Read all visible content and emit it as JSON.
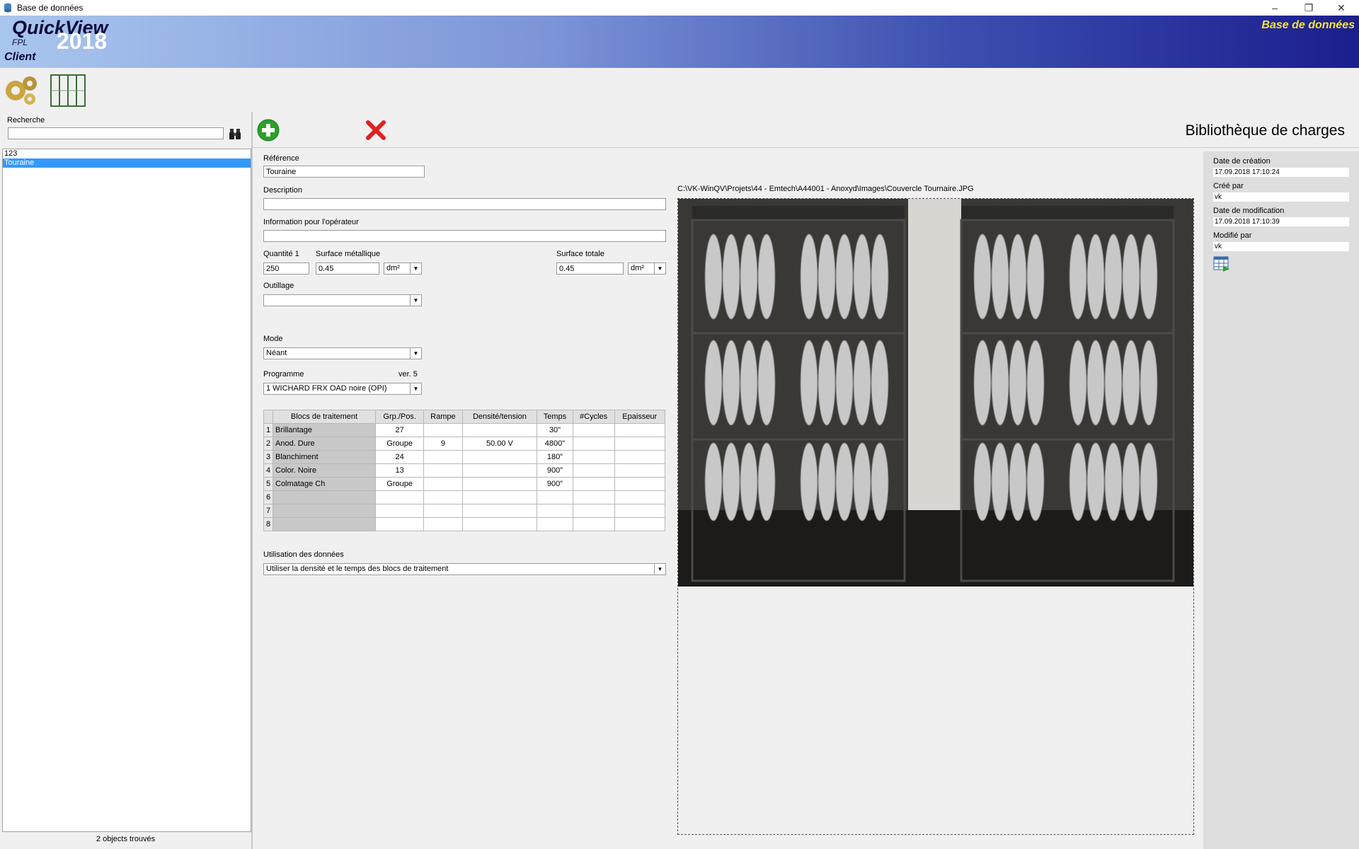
{
  "window": {
    "title": "Base de données"
  },
  "banner": {
    "app_name": "QuickView",
    "sub": "FPL",
    "year": "2018",
    "mode": "Client",
    "section": "Base de données"
  },
  "search": {
    "label": "Recherche",
    "value": ""
  },
  "list": {
    "items": [
      "123",
      "Touraine"
    ],
    "selected": "Touraine",
    "status": "2 objects trouvés"
  },
  "header": {
    "title": "Bibliothèque de charges"
  },
  "form": {
    "reference_label": "Référence",
    "reference_value": "Touraine",
    "description_label": "Description",
    "description_value": "",
    "info_label": "Information pour l'opérateur",
    "info_value": "",
    "quantity_label": "Quantité 1",
    "quantity_value": "250",
    "metal_surface_label": "Surface métallique",
    "metal_surface_value": "0.45",
    "metal_surface_unit": "dm²",
    "total_surface_label": "Surface totale",
    "total_surface_value": "0.45",
    "total_surface_unit": "dm²",
    "tooling_label": "Outillage",
    "tooling_value": "",
    "mode_label": "Mode",
    "mode_value": "Néant",
    "program_label": "Programme",
    "program_version": "ver. 5",
    "program_value": "1 WICHARD FRX OAD noire (OPI)",
    "usage_label": "Utilisation des données",
    "usage_value": "Utiliser la densité et le temps des blocs de traitement"
  },
  "table": {
    "headers": [
      "Blocs de traitement",
      "Grp./Pos.",
      "Rampe",
      "Densité/tension",
      "Temps",
      "#Cycles",
      "Epaisseur"
    ],
    "rows": [
      [
        "1",
        "Brillantage",
        "27",
        "",
        "",
        "30\"",
        "",
        ""
      ],
      [
        "2",
        "Anod. Dure",
        "Groupe",
        "9",
        "50.00 V",
        "4800\"",
        "",
        ""
      ],
      [
        "3",
        "Blanchiment",
        "24",
        "",
        "",
        "180\"",
        "",
        ""
      ],
      [
        "4",
        "Color. Noire",
        "13",
        "",
        "",
        "900\"",
        "",
        ""
      ],
      [
        "5",
        "Colmatage Ch",
        "Groupe",
        "",
        "",
        "900\"",
        "",
        ""
      ],
      [
        "6",
        "",
        "",
        "",
        "",
        "",
        "",
        ""
      ],
      [
        "7",
        "",
        "",
        "",
        "",
        "",
        "",
        ""
      ],
      [
        "8",
        "",
        "",
        "",
        "",
        "",
        "",
        ""
      ]
    ]
  },
  "image": {
    "path": "C:\\VK-WinQV\\Projets\\44 - Emtech\\A44001 - Anoxyd\\Images\\Couvercle Tournaire.JPG"
  },
  "meta": {
    "created_label": "Date de création",
    "created_value": "17.09.2018 17:10:24",
    "created_by_label": "Créé par",
    "created_by_value": "vk",
    "modified_label": "Date de modification",
    "modified_value": "17.09.2018 17:10:39",
    "modified_by_label": "Modifié par",
    "modified_by_value": "vk"
  },
  "icons": {
    "app": "database-icon",
    "tool1": "gears-icon",
    "tool2": "rack-icon",
    "search": "binoculars-icon",
    "add": "add-icon",
    "delete": "delete-icon",
    "export": "spreadsheet-export-icon"
  },
  "colors": {
    "selection": "#3399ff",
    "banner_dark": "#1b1e8e",
    "banner_light": "#a9c6ee",
    "section_text": "#f5e62c",
    "delete": "#e02020",
    "add": "#2aa12a"
  }
}
